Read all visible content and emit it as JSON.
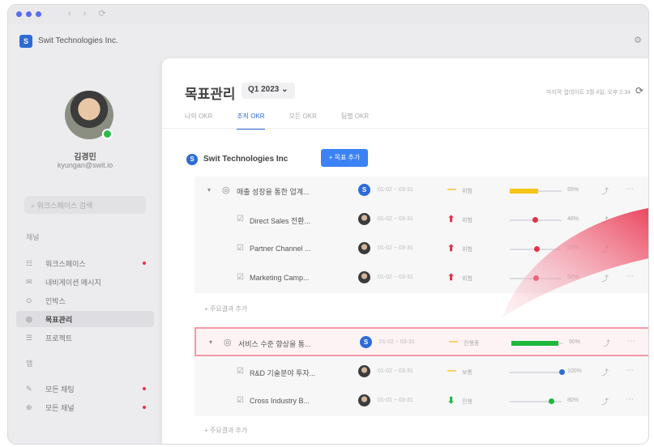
{
  "window": {
    "brand_icon": "S",
    "brand_name": "Swit Technologies Inc.",
    "nav_arrows": "‹ › ⟳",
    "appbar_icon": "settings-icon",
    "traffic_color": "#5a6cf0"
  },
  "sidebar": {
    "user_name": "김경민",
    "user_email": "kyungan@swit.io",
    "search_placeholder": "워크스페이스 검색",
    "section_1": "채널",
    "section_2": "앱",
    "items": [
      {
        "label": "워크스페이스",
        "icon": "☷"
      },
      {
        "label": "내비게이션 메시지",
        "icon": "✉"
      },
      {
        "label": "인박스",
        "icon": "⊙"
      },
      {
        "label": "목표관리",
        "icon": "◎"
      },
      {
        "label": "프로젝트",
        "icon": "☰"
      },
      {
        "label": "모든 채팅",
        "icon": "✎"
      },
      {
        "label": "모든 채널",
        "icon": "⊕"
      }
    ]
  },
  "header": {
    "title": "목표관리",
    "quarter": "Q1 2023 ⌄",
    "right_text": "마지막 업데이트 3월 4일, 오후 2:34",
    "refresh_icon": "⟳"
  },
  "tabs": [
    "나의 OKR",
    "조직 OKR",
    "모든 OKR",
    "팀별 OKR"
  ],
  "org": {
    "icon": "S",
    "name": "Swit Technologies Inc",
    "add_button": "+ 목표 추가"
  },
  "groups": [
    {
      "objective": {
        "title": "매출 성장을 통한 업계...",
        "owner_type": "badge",
        "owner_badge": "S",
        "date": "01-02 ~ 03-31",
        "status_icon": "—",
        "status_color": "#f5b400",
        "state": "위험",
        "progress": 0.55,
        "bar_color": "#f5c518",
        "percent": "55%"
      },
      "key_results": [
        {
          "title": "Direct Sales 전환...",
          "date": "01-02 ~ 03-31",
          "status_icon": "⬆",
          "status_color": "#e0334a",
          "state": "위험",
          "progress": 0.48,
          "marker_color": "#e0334a",
          "percent": "48%"
        },
        {
          "title": "Partner Channel ...",
          "date": "01-02 ~ 03-31",
          "status_icon": "⬆",
          "status_color": "#e0334a",
          "state": "위험",
          "progress": 0.52,
          "marker_color": "#e0334a",
          "percent": "52%"
        },
        {
          "title": "Marketing Camp...",
          "date": "01-02 ~ 03-31",
          "status_icon": "⬆",
          "status_color": "#e0334a",
          "state": "위험",
          "progress": 0.5,
          "marker_color": "#e0334a",
          "percent": "50%"
        }
      ],
      "add_kr": "+ 주요결과 추가"
    },
    {
      "objective": {
        "title": "서비스 수준 향상을 통...",
        "owner_type": "badge",
        "owner_badge": "S",
        "date": "01-02 ~ 03-31",
        "status_icon": "—",
        "status_color": "#f5b400",
        "state": "진행중",
        "progress": 0.9,
        "bar_color": "#1fb83a",
        "percent": "90%"
      },
      "key_results": [
        {
          "title": "R&D 기술분야 투자...",
          "date": "01-02 ~ 03-31",
          "status_icon": "—",
          "status_color": "#f5b400",
          "state": "보통",
          "progress": 1.0,
          "marker_color": "#2e6bd8",
          "percent": "100%"
        },
        {
          "title": "Cross Industry B...",
          "date": "01-01 ~ 03-31",
          "status_icon": "⬇",
          "status_color": "#1fb83a",
          "state": "진행",
          "progress": 0.8,
          "marker_color": "#1fb83a",
          "percent": "80%"
        }
      ],
      "add_kr": "+ 주요결과 추가"
    }
  ]
}
